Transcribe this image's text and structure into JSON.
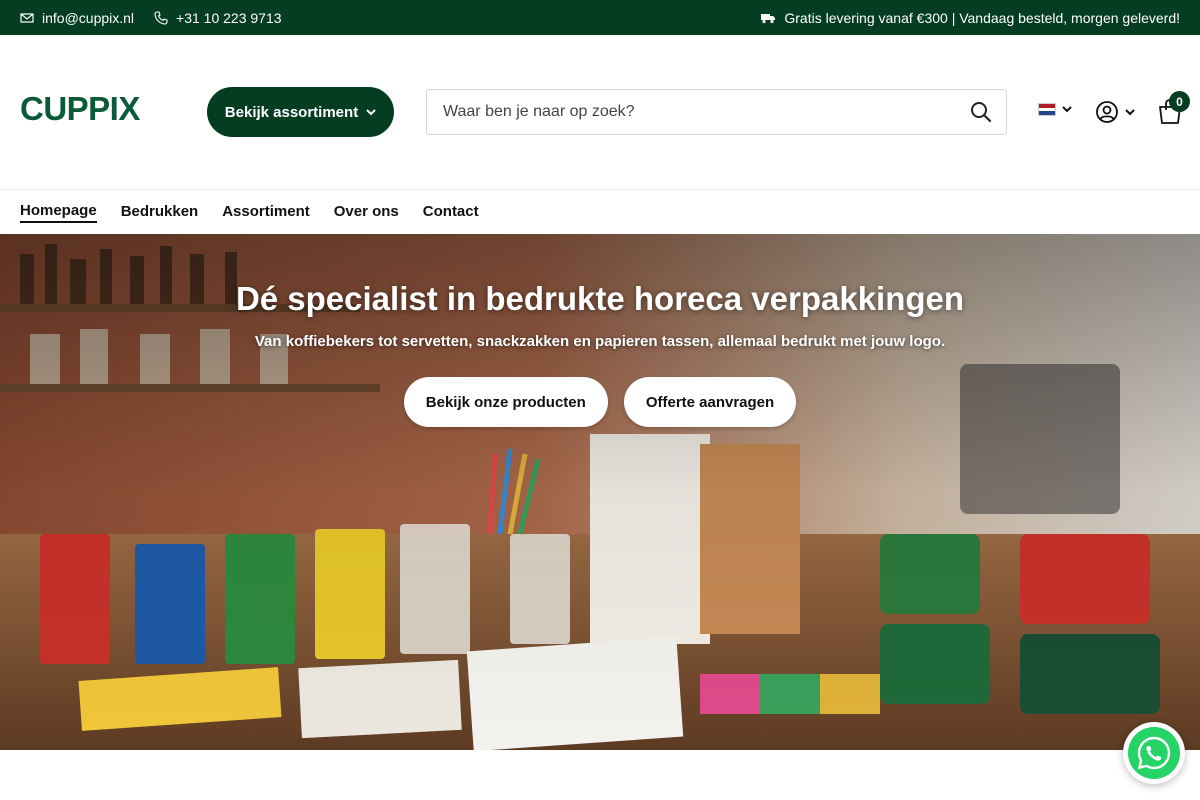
{
  "topbar": {
    "email": "info@cuppix.nl",
    "phone": "+31 10 223 9713",
    "shipping": "Gratis levering vanaf €300 | Vandaag besteld, morgen geleverd!"
  },
  "header": {
    "logo_text": "CUPPIX",
    "assortment_button": "Bekijk assortiment",
    "search_placeholder": "Waar ben je naar op zoek?",
    "cart_count": "0"
  },
  "nav": {
    "items": [
      {
        "label": "Homepage"
      },
      {
        "label": "Bedrukken"
      },
      {
        "label": "Assortiment"
      },
      {
        "label": "Over ons"
      },
      {
        "label": "Contact"
      }
    ]
  },
  "hero": {
    "title": "Dé specialist in bedrukte horeca verpakkingen",
    "subtitle": "Van koffiebekers tot servetten, snackzakken en papieren tassen, allemaal bedrukt met jouw logo.",
    "primary_button": "Bekijk onze producten",
    "secondary_button": "Offerte aanvragen"
  },
  "colors": {
    "brand_green": "#043d22",
    "logo_green": "#0b5a3a",
    "white": "#ffffff"
  }
}
